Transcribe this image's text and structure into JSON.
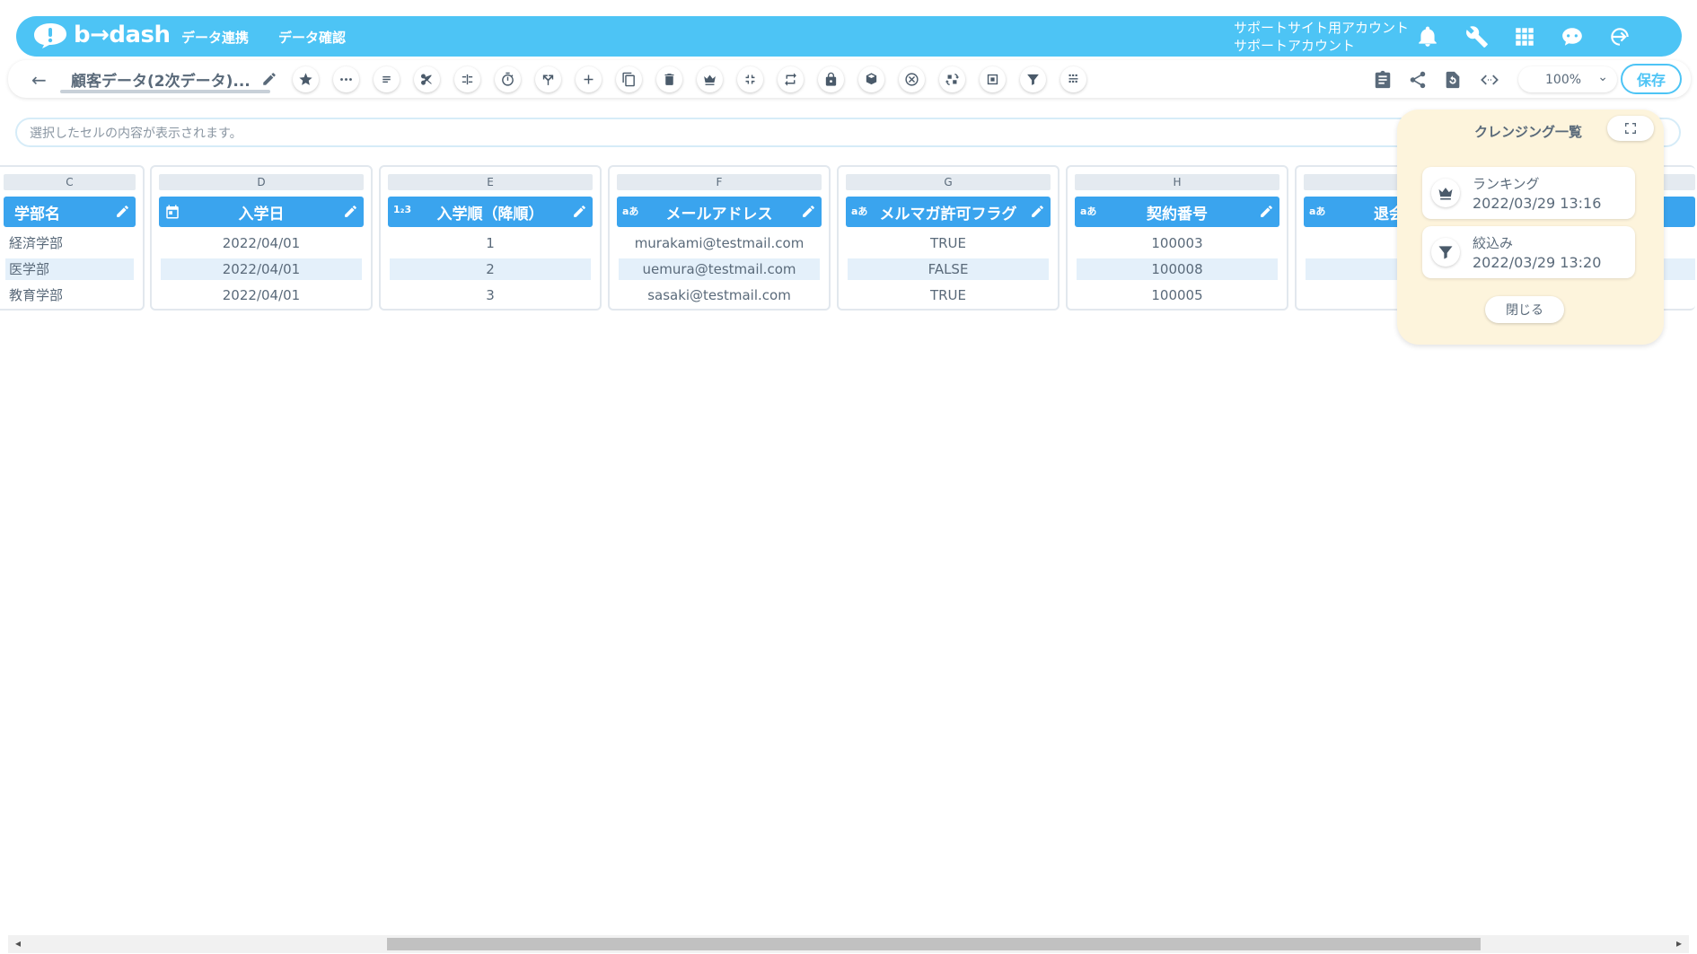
{
  "header": {
    "logo_text": "b→dash",
    "nav": [
      "データ連携",
      "データ確認"
    ],
    "account_line1": "サポートサイト用アカウント",
    "account_line2": "サポートアカウント"
  },
  "toolbar": {
    "doc_name": "顧客データ(2次データ)...",
    "zoom": "100%",
    "save_label": "保存"
  },
  "cellbar": {
    "placeholder": "選択したセルの内容が表示されます。"
  },
  "columns": [
    {
      "letter": "C",
      "header": "学部名",
      "type": "",
      "cells": [
        "経済学部",
        "医学部",
        "教育学部"
      ]
    },
    {
      "letter": "D",
      "header": "入学日",
      "type": "date",
      "cells": [
        "2022/04/01",
        "2022/04/01",
        "2022/04/01"
      ]
    },
    {
      "letter": "E",
      "header": "入学順（降順）",
      "type": "1₂3",
      "cells": [
        "1",
        "2",
        "3"
      ]
    },
    {
      "letter": "F",
      "header": "メールアドレス",
      "type": "aあ",
      "cells": [
        "murakami@testmail.com",
        "uemura@testmail.com",
        "sasaki@testmail.com"
      ]
    },
    {
      "letter": "G",
      "header": "メルマガ許可フラグ",
      "type": "aあ",
      "cells": [
        "TRUE",
        "FALSE",
        "TRUE"
      ]
    },
    {
      "letter": "H",
      "header": "契約番号",
      "type": "aあ",
      "cells": [
        "100003",
        "100008",
        "100005"
      ]
    },
    {
      "letter": "",
      "header": "退会",
      "type": "aあ",
      "cells": [
        "",
        "",
        ""
      ]
    }
  ],
  "cleansing_panel": {
    "title": "クレンジング一覧",
    "items": [
      {
        "name": "ランキング",
        "date": "2022/03/29 13:16",
        "icon": "crown-icon"
      },
      {
        "name": "絞込み",
        "date": "2022/03/29 13:20",
        "icon": "filter-icon"
      }
    ],
    "close_label": "閉じる"
  },
  "colors": {
    "brand": "#4dc4f5",
    "column_header": "#3aa4ee",
    "panel_bg": "#fdf4dc"
  }
}
